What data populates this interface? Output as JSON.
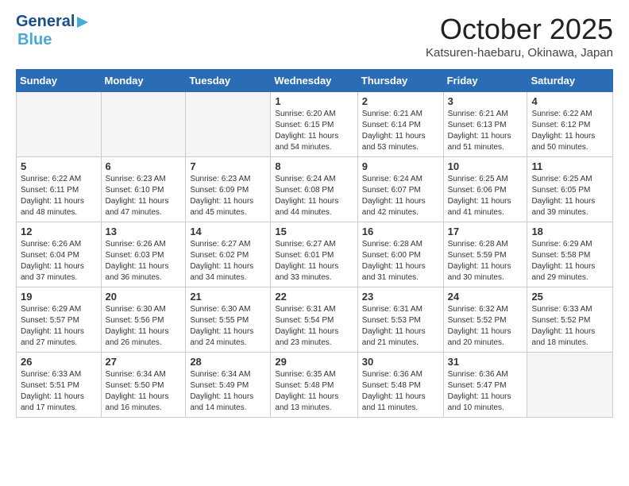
{
  "header": {
    "logo_general": "General",
    "logo_blue": "Blue",
    "month_title": "October 2025",
    "location": "Katsuren-haebaru, Okinawa, Japan"
  },
  "weekdays": [
    "Sunday",
    "Monday",
    "Tuesday",
    "Wednesday",
    "Thursday",
    "Friday",
    "Saturday"
  ],
  "weeks": [
    [
      {
        "day": "",
        "sunrise": "",
        "sunset": "",
        "daylight": "",
        "empty": true
      },
      {
        "day": "",
        "sunrise": "",
        "sunset": "",
        "daylight": "",
        "empty": true
      },
      {
        "day": "",
        "sunrise": "",
        "sunset": "",
        "daylight": "",
        "empty": true
      },
      {
        "day": "1",
        "sunrise": "Sunrise: 6:20 AM",
        "sunset": "Sunset: 6:15 PM",
        "daylight": "Daylight: 11 hours and 54 minutes."
      },
      {
        "day": "2",
        "sunrise": "Sunrise: 6:21 AM",
        "sunset": "Sunset: 6:14 PM",
        "daylight": "Daylight: 11 hours and 53 minutes."
      },
      {
        "day": "3",
        "sunrise": "Sunrise: 6:21 AM",
        "sunset": "Sunset: 6:13 PM",
        "daylight": "Daylight: 11 hours and 51 minutes."
      },
      {
        "day": "4",
        "sunrise": "Sunrise: 6:22 AM",
        "sunset": "Sunset: 6:12 PM",
        "daylight": "Daylight: 11 hours and 50 minutes."
      }
    ],
    [
      {
        "day": "5",
        "sunrise": "Sunrise: 6:22 AM",
        "sunset": "Sunset: 6:11 PM",
        "daylight": "Daylight: 11 hours and 48 minutes."
      },
      {
        "day": "6",
        "sunrise": "Sunrise: 6:23 AM",
        "sunset": "Sunset: 6:10 PM",
        "daylight": "Daylight: 11 hours and 47 minutes."
      },
      {
        "day": "7",
        "sunrise": "Sunrise: 6:23 AM",
        "sunset": "Sunset: 6:09 PM",
        "daylight": "Daylight: 11 hours and 45 minutes."
      },
      {
        "day": "8",
        "sunrise": "Sunrise: 6:24 AM",
        "sunset": "Sunset: 6:08 PM",
        "daylight": "Daylight: 11 hours and 44 minutes."
      },
      {
        "day": "9",
        "sunrise": "Sunrise: 6:24 AM",
        "sunset": "Sunset: 6:07 PM",
        "daylight": "Daylight: 11 hours and 42 minutes."
      },
      {
        "day": "10",
        "sunrise": "Sunrise: 6:25 AM",
        "sunset": "Sunset: 6:06 PM",
        "daylight": "Daylight: 11 hours and 41 minutes."
      },
      {
        "day": "11",
        "sunrise": "Sunrise: 6:25 AM",
        "sunset": "Sunset: 6:05 PM",
        "daylight": "Daylight: 11 hours and 39 minutes."
      }
    ],
    [
      {
        "day": "12",
        "sunrise": "Sunrise: 6:26 AM",
        "sunset": "Sunset: 6:04 PM",
        "daylight": "Daylight: 11 hours and 37 minutes."
      },
      {
        "day": "13",
        "sunrise": "Sunrise: 6:26 AM",
        "sunset": "Sunset: 6:03 PM",
        "daylight": "Daylight: 11 hours and 36 minutes."
      },
      {
        "day": "14",
        "sunrise": "Sunrise: 6:27 AM",
        "sunset": "Sunset: 6:02 PM",
        "daylight": "Daylight: 11 hours and 34 minutes."
      },
      {
        "day": "15",
        "sunrise": "Sunrise: 6:27 AM",
        "sunset": "Sunset: 6:01 PM",
        "daylight": "Daylight: 11 hours and 33 minutes."
      },
      {
        "day": "16",
        "sunrise": "Sunrise: 6:28 AM",
        "sunset": "Sunset: 6:00 PM",
        "daylight": "Daylight: 11 hours and 31 minutes."
      },
      {
        "day": "17",
        "sunrise": "Sunrise: 6:28 AM",
        "sunset": "Sunset: 5:59 PM",
        "daylight": "Daylight: 11 hours and 30 minutes."
      },
      {
        "day": "18",
        "sunrise": "Sunrise: 6:29 AM",
        "sunset": "Sunset: 5:58 PM",
        "daylight": "Daylight: 11 hours and 29 minutes."
      }
    ],
    [
      {
        "day": "19",
        "sunrise": "Sunrise: 6:29 AM",
        "sunset": "Sunset: 5:57 PM",
        "daylight": "Daylight: 11 hours and 27 minutes."
      },
      {
        "day": "20",
        "sunrise": "Sunrise: 6:30 AM",
        "sunset": "Sunset: 5:56 PM",
        "daylight": "Daylight: 11 hours and 26 minutes."
      },
      {
        "day": "21",
        "sunrise": "Sunrise: 6:30 AM",
        "sunset": "Sunset: 5:55 PM",
        "daylight": "Daylight: 11 hours and 24 minutes."
      },
      {
        "day": "22",
        "sunrise": "Sunrise: 6:31 AM",
        "sunset": "Sunset: 5:54 PM",
        "daylight": "Daylight: 11 hours and 23 minutes."
      },
      {
        "day": "23",
        "sunrise": "Sunrise: 6:31 AM",
        "sunset": "Sunset: 5:53 PM",
        "daylight": "Daylight: 11 hours and 21 minutes."
      },
      {
        "day": "24",
        "sunrise": "Sunrise: 6:32 AM",
        "sunset": "Sunset: 5:52 PM",
        "daylight": "Daylight: 11 hours and 20 minutes."
      },
      {
        "day": "25",
        "sunrise": "Sunrise: 6:33 AM",
        "sunset": "Sunset: 5:52 PM",
        "daylight": "Daylight: 11 hours and 18 minutes."
      }
    ],
    [
      {
        "day": "26",
        "sunrise": "Sunrise: 6:33 AM",
        "sunset": "Sunset: 5:51 PM",
        "daylight": "Daylight: 11 hours and 17 minutes."
      },
      {
        "day": "27",
        "sunrise": "Sunrise: 6:34 AM",
        "sunset": "Sunset: 5:50 PM",
        "daylight": "Daylight: 11 hours and 16 minutes."
      },
      {
        "day": "28",
        "sunrise": "Sunrise: 6:34 AM",
        "sunset": "Sunset: 5:49 PM",
        "daylight": "Daylight: 11 hours and 14 minutes."
      },
      {
        "day": "29",
        "sunrise": "Sunrise: 6:35 AM",
        "sunset": "Sunset: 5:48 PM",
        "daylight": "Daylight: 11 hours and 13 minutes."
      },
      {
        "day": "30",
        "sunrise": "Sunrise: 6:36 AM",
        "sunset": "Sunset: 5:48 PM",
        "daylight": "Daylight: 11 hours and 11 minutes."
      },
      {
        "day": "31",
        "sunrise": "Sunrise: 6:36 AM",
        "sunset": "Sunset: 5:47 PM",
        "daylight": "Daylight: 11 hours and 10 minutes."
      },
      {
        "day": "",
        "sunrise": "",
        "sunset": "",
        "daylight": "",
        "empty": true
      }
    ]
  ]
}
